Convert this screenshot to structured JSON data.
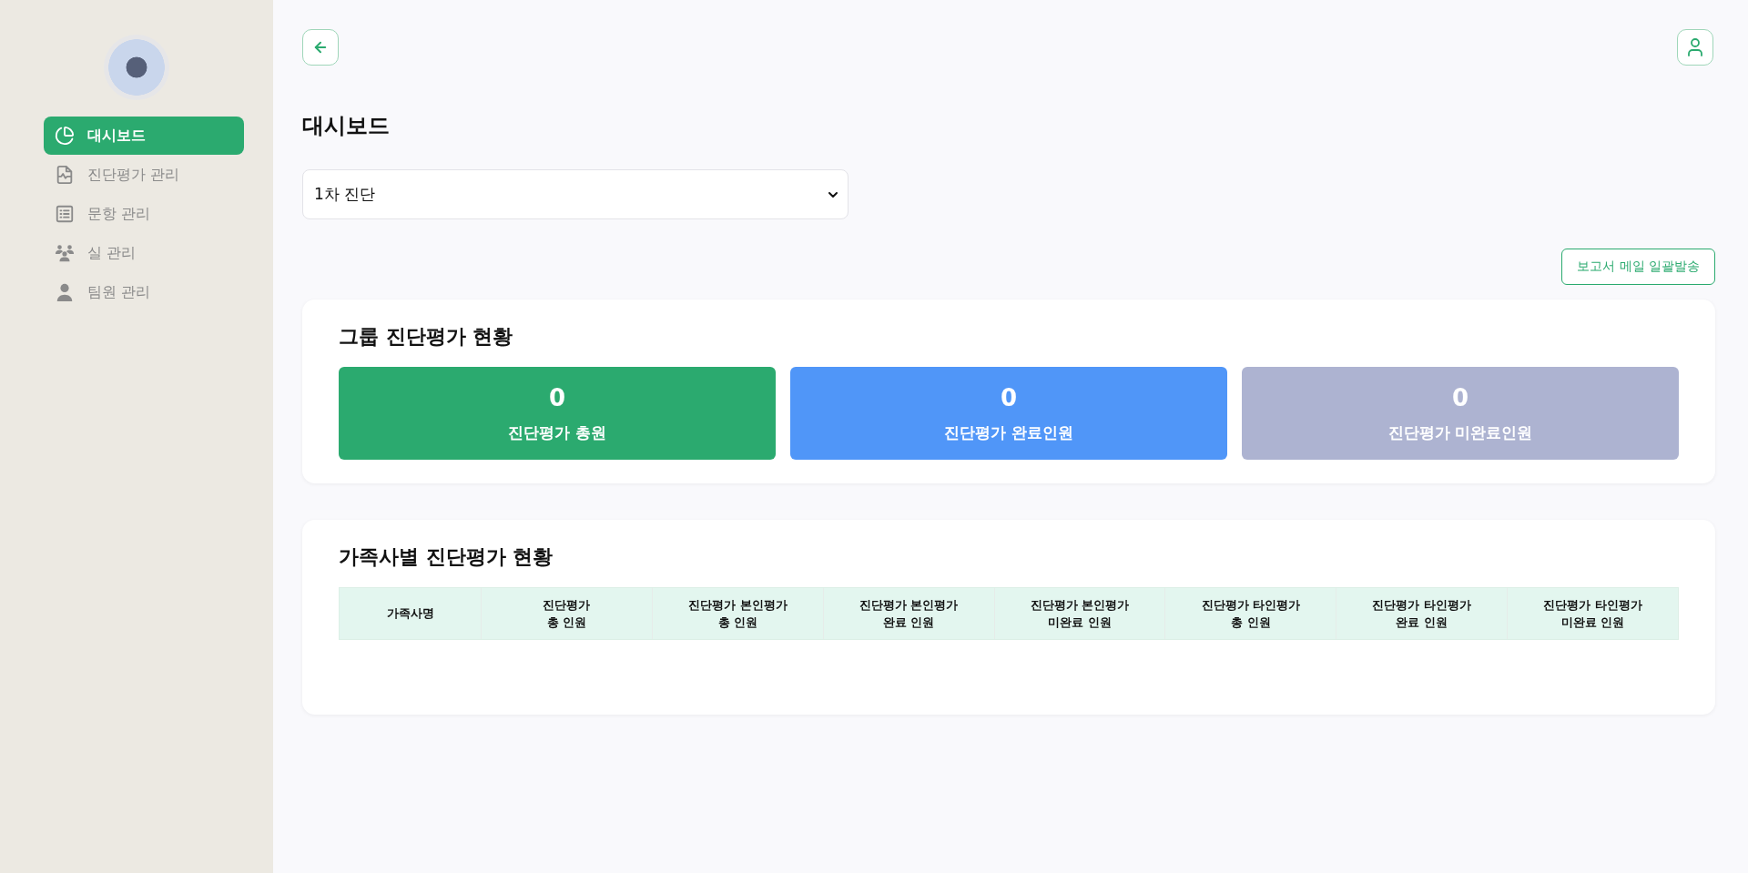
{
  "sidebar": {
    "items": [
      {
        "label": "대시보드",
        "selected": true
      },
      {
        "label": "진단평가 관리",
        "selected": false
      },
      {
        "label": "문항 관리",
        "selected": false
      },
      {
        "label": "실 관리",
        "selected": false
      },
      {
        "label": "팀원 관리",
        "selected": false
      }
    ]
  },
  "page": {
    "title": "대시보드"
  },
  "round_select": {
    "value": "1차 진단"
  },
  "report_button": "보고서 메일 일괄발송",
  "group_status": {
    "title": "그룹 진단평가 현황",
    "stats": [
      {
        "value": "0",
        "label": "진단평가 총원",
        "color": "#2baa6f"
      },
      {
        "value": "0",
        "label": "진단평가 완료인원",
        "color": "#5096f8"
      },
      {
        "value": "0",
        "label": "진단평가 미완료인원",
        "color": "#adb3d1"
      }
    ]
  },
  "family_status": {
    "title": "가족사별 진단평가 현황",
    "table": {
      "columns": [
        "가족사명",
        "진단평가\n총 인원",
        "진단평가 본인평가\n총 인원",
        "진단평가 본인평가\n완료 인원",
        "진단평가 본인평가\n미완료 인원",
        "진단평가 타인평가\n총 인원",
        "진단평가 타인평가\n완료 인원",
        "진단평가 타인평가\n미완료 인원"
      ]
    }
  }
}
